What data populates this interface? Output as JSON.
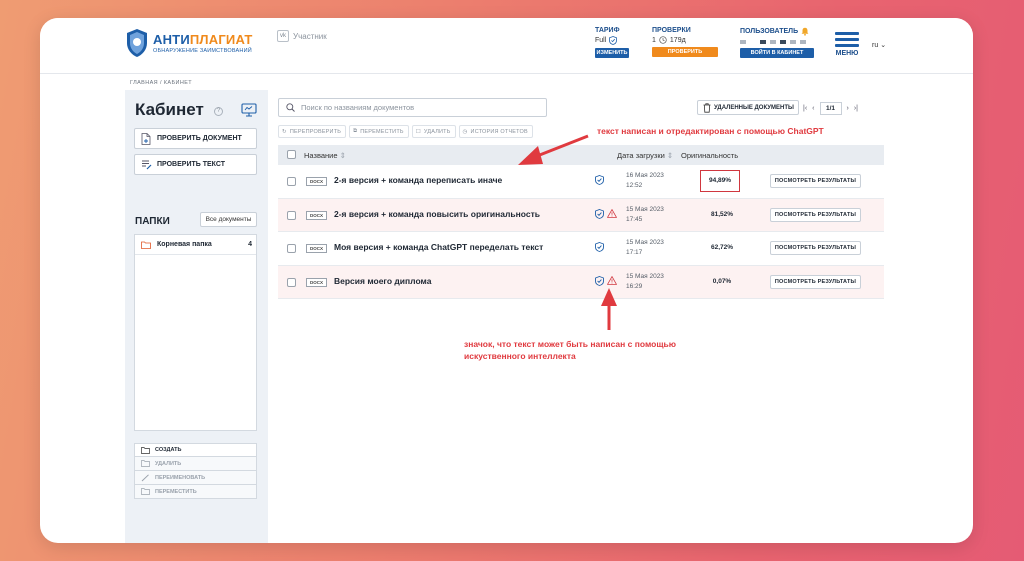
{
  "header": {
    "logo_main_a": "АНТИ",
    "logo_main_b": "ПЛАГИАТ",
    "logo_sub": "ОБНАРУЖЕНИЕ ЗАИМСТВОВАНИЙ",
    "role": "Участник",
    "tariff": {
      "label": "ТАРИФ",
      "value": "Full",
      "button": "ИЗМЕНИТЬ"
    },
    "checks": {
      "label": "ПРОВЕРКИ",
      "value": "1",
      "days": "179д",
      "button": "ПРОВЕРИТЬ ДОКУМЕНТ"
    },
    "user": {
      "label": "ПОЛЬЗОВАТЕЛЬ",
      "button": "ВОЙТИ В КАБИНЕТ"
    },
    "menu_label": "МЕНЮ",
    "lang": "ru"
  },
  "breadcrumb": "ГЛАВНАЯ  /  КАБИНЕТ",
  "sidebar": {
    "title": "Кабинет",
    "check_document": "ПРОВЕРИТЬ ДОКУМЕНТ",
    "check_text": "ПРОВЕРИТЬ ТЕКСТ",
    "folders_label": "ПАПКИ",
    "all_docs": "Все документы",
    "folders": [
      {
        "name": "Корневая папка",
        "count": "4"
      }
    ],
    "actions": [
      "СОЗДАТЬ",
      "УДАЛИТЬ",
      "ПЕРЕИМЕНОВАТЬ",
      "ПЕРЕМЕСТИТЬ"
    ]
  },
  "search": {
    "placeholder": "Поиск по названиям документов"
  },
  "deleted_docs": "УДАЛЕННЫЕ ДОКУМЕНТЫ",
  "pager": {
    "page": "1/1"
  },
  "toolbar": [
    "ПЕРЕПРОВЕРИТЬ",
    "ПЕРЕМЕСТИТЬ",
    "УДАЛИТЬ",
    "ИСТОРИЯ ОТЧЕТОВ"
  ],
  "table": {
    "col_name": "Название",
    "col_date": "Дата загрузки",
    "col_orig": "Оригинальность",
    "result_button": "ПОСМОТРЕТЬ РЕЗУЛЬТАТЫ",
    "rows": [
      {
        "type": "DOCX",
        "title": "2-я версия + команда переписать иначе",
        "date": "16 Мая 2023",
        "time": "12:52",
        "orig": "94,89%",
        "warn": false,
        "highlight": true
      },
      {
        "type": "DOCX",
        "title": "2-я версия + команда повысить оригинальность",
        "date": "15 Мая 2023",
        "time": "17:45",
        "orig": "81,52%",
        "warn": true,
        "highlight": false
      },
      {
        "type": "DOCX",
        "title": "Моя версия + команда ChatGPT переделать текст",
        "date": "15 Мая 2023",
        "time": "17:17",
        "orig": "62,72%",
        "warn": false,
        "highlight": false
      },
      {
        "type": "DOCX",
        "title": "Версия моего диплома",
        "date": "15 Мая 2023",
        "time": "16:29",
        "orig": "0,07%",
        "warn": true,
        "highlight": false
      }
    ]
  },
  "annotations": {
    "top": "текст написан и отредактирован с помощью ChatGPT",
    "bottom_line1": "значок, что текст может быть написан с помощью",
    "bottom_line2": "искуственного интеллекта"
  },
  "colors": {
    "brand_blue": "#1d5ea8",
    "brand_orange": "#f08a1c",
    "annotation_red": "#e03a3f"
  }
}
